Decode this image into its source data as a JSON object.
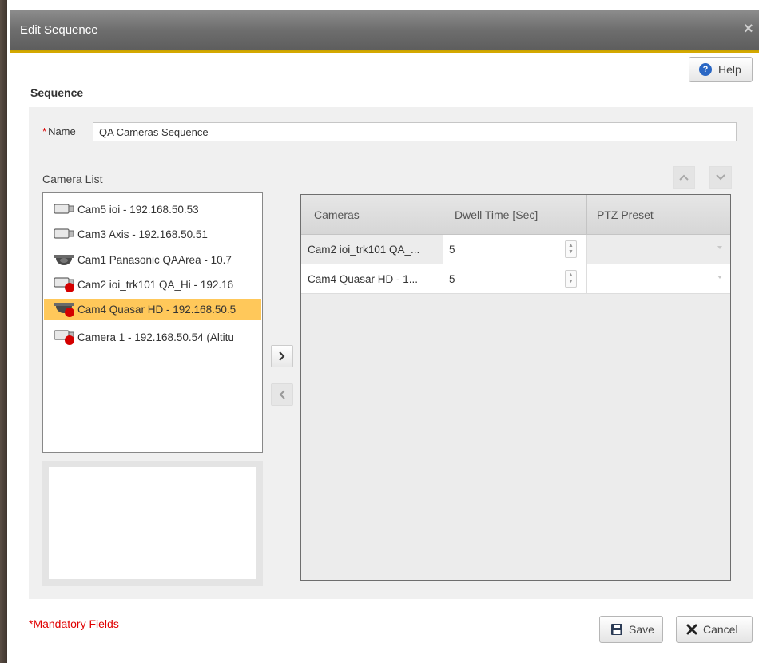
{
  "window": {
    "title": "Edit Sequence",
    "close_glyph": "×"
  },
  "help": {
    "label": "Help",
    "icon": "help-question-icon"
  },
  "section": {
    "title": "Sequence"
  },
  "name_field": {
    "required_mark": "*",
    "label": "Name",
    "value": "QA Cameras Sequence"
  },
  "camera_list": {
    "label": "Camera List",
    "items": [
      {
        "label": "Cam5 ioi - 192.168.50.53",
        "icon": "box-camera-icon",
        "selected": false
      },
      {
        "label": "Cam3 Axis - 192.168.50.51",
        "icon": "box-camera-icon",
        "selected": false
      },
      {
        "label": "Cam1 Panasonic QAArea - 10.7",
        "icon": "dome-camera-icon",
        "selected": false
      },
      {
        "label": "Cam2 ioi_trk101 QA_Hi - 192.16",
        "icon": "box-camera-recording-icon",
        "selected": false
      },
      {
        "label": "Cam4 Quasar HD - 192.168.50.5",
        "icon": "dome-camera-recording-icon",
        "selected": true
      },
      {
        "label": "Camera 1 - 192.168.50.54 (Altitu",
        "icon": "box-camera-recording-icon",
        "selected": false
      }
    ]
  },
  "grid": {
    "columns": [
      "Cameras",
      "Dwell Time [Sec]",
      "PTZ Preset"
    ],
    "rows": [
      {
        "camera": "Cam2 ioi_trk101 QA_...",
        "dwell": "5",
        "ptz": ""
      },
      {
        "camera": "Cam4 Quasar HD - 1...",
        "dwell": "5",
        "ptz": ""
      }
    ]
  },
  "footer": {
    "mandatory": "*Mandatory Fields",
    "save": "Save",
    "cancel": "Cancel"
  },
  "colors": {
    "accent": "#d4a800",
    "selection": "#ffc85a",
    "required": "#e00000",
    "help_icon": "#2a67c4"
  }
}
